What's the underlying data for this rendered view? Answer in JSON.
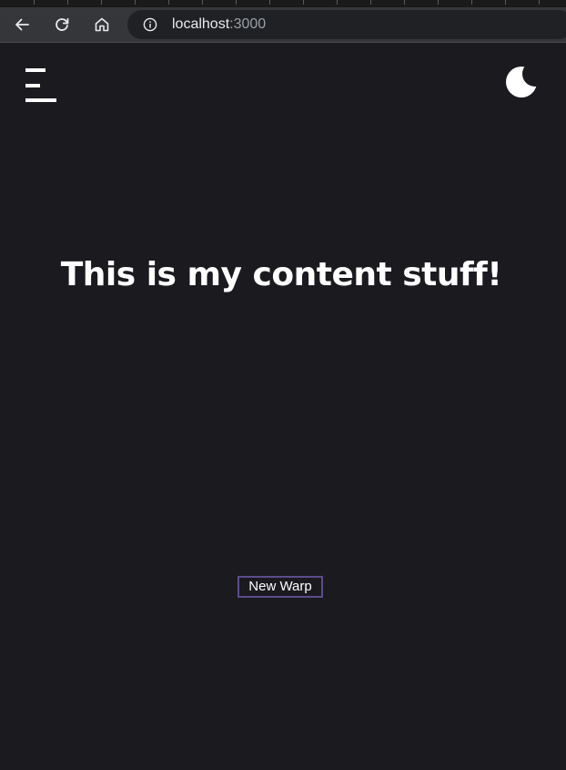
{
  "browser": {
    "url_host": "localhost",
    "url_port": ":3000",
    "icons": {
      "back": "back-arrow-icon",
      "reload": "reload-icon",
      "home": "home-icon",
      "info": "info-icon"
    }
  },
  "page": {
    "headline": "This is my content stuff!",
    "warp_button_label": "New Warp",
    "icons": {
      "menu": "menu-icon",
      "theme": "moon-icon"
    }
  },
  "colors": {
    "page_background": "#1b1a1f",
    "text": "#ffffff",
    "button_border": "#5c4c8c",
    "toolbar": "#35363a",
    "omnibox": "#202124"
  }
}
